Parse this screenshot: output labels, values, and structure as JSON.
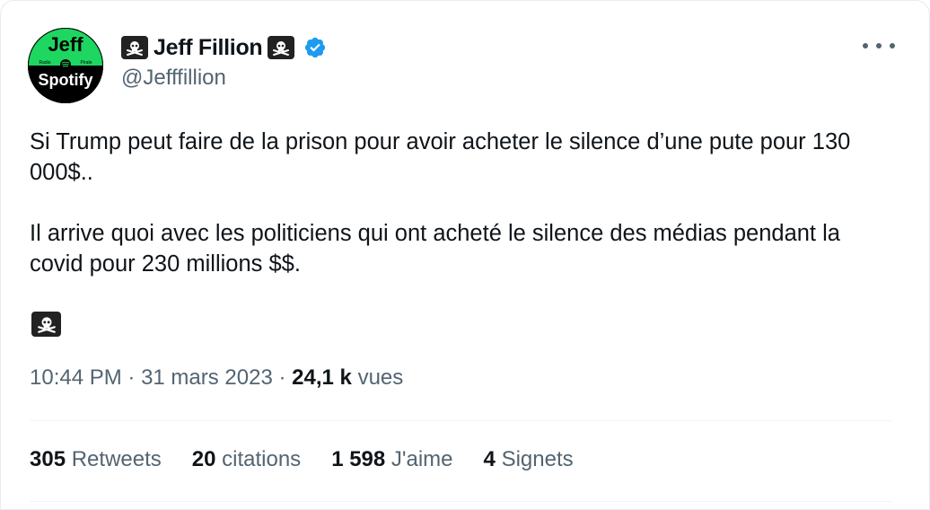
{
  "author": {
    "display_name": "Jeff Fillion",
    "handle": "@Jefffillion",
    "name_emoji": "skull-and-crossbones",
    "avatar": {
      "top_text": "Jeff",
      "small_left": "Radio",
      "small_right": "Pirate",
      "bottom_text": "Spotify",
      "green": "#1ed760"
    },
    "verified_color": "#1d9bf0"
  },
  "tweet": {
    "paragraph_1": "Si Trump peut faire de la prison pour avoir acheter le silence d’une pute pour 130 000$..",
    "paragraph_2": "Il arrive quoi avec les politiciens qui ont acheté le silence des médias pendant la covid pour 230 millions $$.",
    "trailing_emoji": "skull-and-crossbones"
  },
  "meta": {
    "time": "10:44 PM",
    "separator": " · ",
    "date": "31 mars 2023",
    "views_count": "24,1 k",
    "views_label": "vues"
  },
  "stats": {
    "retweets_count": "305",
    "retweets_label": "Retweets",
    "quotes_count": "20",
    "quotes_label": "citations",
    "likes_count": "1 598",
    "likes_label": "J'aime",
    "bookmarks_count": "4",
    "bookmarks_label": "Signets"
  }
}
